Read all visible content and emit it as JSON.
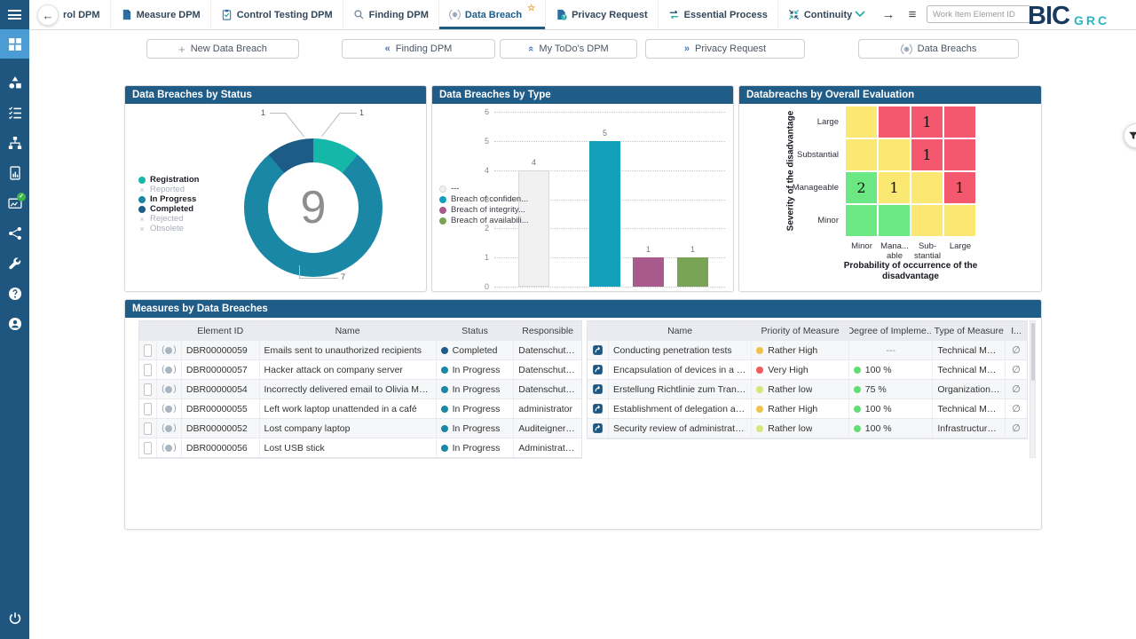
{
  "app": {
    "logo_primary": "BIC",
    "logo_secondary": "GRC",
    "work_item_placeholder": "Work Item Element ID"
  },
  "nav_icons": {
    "back": "←",
    "forward": "→",
    "menu": "≡"
  },
  "topnav": {
    "tabs": [
      {
        "label": "rol DPM",
        "icon": "none",
        "active": false,
        "starred": false
      },
      {
        "label": "Measure DPM",
        "icon": "doc",
        "active": false,
        "starred": false
      },
      {
        "label": "Control Testing DPM",
        "icon": "clipboard",
        "active": false,
        "starred": false
      },
      {
        "label": "Finding DPM",
        "icon": "magnifier",
        "active": false,
        "starred": false
      },
      {
        "label": "Data Breach",
        "icon": "breach",
        "active": true,
        "starred": true
      },
      {
        "label": "Privacy Request",
        "icon": "doc-question",
        "active": false,
        "starred": false
      },
      {
        "label": "Essential Process",
        "icon": "swap-arrows",
        "active": false,
        "starred": false
      },
      {
        "label": "Continuity Strategy",
        "icon": "collapse-arrows",
        "active": false,
        "starred": false
      }
    ]
  },
  "actions": [
    {
      "label": "New Data Breach",
      "icon": "plus"
    },
    {
      "label": "Finding DPM",
      "icon": "chevrons-left"
    },
    {
      "label": "My ToDo's DPM",
      "icon": "chevrons-up"
    },
    {
      "label": "Privacy Request",
      "icon": "chevrons-right"
    },
    {
      "label": "Data Breachs",
      "icon": "breach"
    }
  ],
  "sidebar": {
    "items": [
      {
        "icon": "dashboard",
        "active": true
      },
      {
        "icon": "shapes",
        "active": false
      },
      {
        "icon": "checklist",
        "active": false
      },
      {
        "icon": "hierarchy",
        "active": false
      },
      {
        "icon": "report",
        "active": false
      },
      {
        "icon": "approval",
        "active": false,
        "badge": true
      },
      {
        "icon": "share",
        "active": false
      },
      {
        "icon": "wrench",
        "active": false
      },
      {
        "icon": "help",
        "active": false
      },
      {
        "icon": "account",
        "active": false
      }
    ],
    "bottom_icon": "power"
  },
  "chart_data": [
    {
      "type": "donut",
      "title": "Data Breaches by Status",
      "total": 9,
      "segments": [
        {
          "label": "Registration",
          "value": 1,
          "color": "#15b7a8"
        },
        {
          "label": "In Progress",
          "value": 7,
          "color": "#1a87a5"
        },
        {
          "label": "Completed",
          "value": 1,
          "color": "#1d5c87"
        }
      ],
      "callouts": [
        {
          "value": 1,
          "segment": "Completed",
          "position": "top-left"
        },
        {
          "value": 1,
          "segment": "Registration",
          "position": "top-right"
        },
        {
          "value": 7,
          "segment": "In Progress",
          "position": "bottom"
        }
      ],
      "legend": [
        {
          "label": "Registration",
          "color": "#15b7a8",
          "enabled": true
        },
        {
          "label": "Reported",
          "color": null,
          "enabled": false
        },
        {
          "label": "In Progress",
          "color": "#1a87a5",
          "enabled": true
        },
        {
          "label": "Completed",
          "color": "#1d5c87",
          "enabled": true
        },
        {
          "label": "Rejected",
          "color": null,
          "enabled": false
        },
        {
          "label": "Obsolete",
          "color": null,
          "enabled": false
        }
      ]
    },
    {
      "type": "bar",
      "title": "Data Breaches by Type",
      "ylim": [
        0,
        6
      ],
      "yticks": [
        0,
        1,
        2,
        3,
        4,
        5,
        6
      ],
      "grid": true,
      "legend_position": "left",
      "bars": [
        {
          "label": "---",
          "value": 4,
          "color": "#f1f1f1",
          "border": "#d8d8d8"
        },
        {
          "label": "Breach of confiden...",
          "value": 5,
          "color": "#13a0ba",
          "border": "#13a0ba"
        },
        {
          "label": "Breach of integrity...",
          "value": 1,
          "color": "#a85a8c",
          "border": "#a85a8c"
        },
        {
          "label": "Breach of availabili...",
          "value": 1,
          "color": "#7aa455",
          "border": "#7aa455"
        }
      ]
    },
    {
      "type": "heatmap",
      "title": "Databreachs by Overall Evaluation",
      "ylabel": "Severity of the disadvantage",
      "xlabel_lines": [
        "Probability of occurrence of the",
        "disadvantage"
      ],
      "row_labels": [
        "Large",
        "Substantial",
        "Manageable",
        "Minor"
      ],
      "col_labels": [
        [
          "Minor"
        ],
        [
          "Mana...",
          "able"
        ],
        [
          "Sub-",
          "stantial"
        ],
        [
          "Large"
        ]
      ],
      "palette": {
        "Y": "#fae873",
        "R": "#f4586e",
        "G": "#6be784"
      },
      "cells": [
        [
          {
            "c": "Y",
            "v": null
          },
          {
            "c": "R",
            "v": null
          },
          {
            "c": "R",
            "v": 1
          },
          {
            "c": "R",
            "v": null
          }
        ],
        [
          {
            "c": "Y",
            "v": null
          },
          {
            "c": "Y",
            "v": null
          },
          {
            "c": "R",
            "v": 1
          },
          {
            "c": "R",
            "v": null
          }
        ],
        [
          {
            "c": "G",
            "v": 2
          },
          {
            "c": "Y",
            "v": 1
          },
          {
            "c": "Y",
            "v": null
          },
          {
            "c": "R",
            "v": 1
          }
        ],
        [
          {
            "c": "G",
            "v": null
          },
          {
            "c": "G",
            "v": null
          },
          {
            "c": "Y",
            "v": null
          },
          {
            "c": "Y",
            "v": null
          }
        ]
      ]
    }
  ],
  "measures": {
    "title": "Measures by Data Breaches",
    "left": {
      "headers": [
        "",
        "",
        "Element ID",
        "Name",
        "Status",
        "Responsible"
      ],
      "rows": [
        {
          "element_id": "DBR00000059",
          "name": "Emails sent to unauthorized recipients",
          "status": "Completed",
          "status_color": "#1d5c87",
          "responsible": "Datenschutzkoordi..."
        },
        {
          "element_id": "DBR00000057",
          "name": "Hacker attack on company server",
          "status": "In Progress",
          "status_color": "#1a87a5",
          "responsible": "Datenschutzkoordi..."
        },
        {
          "element_id": "DBR00000054",
          "name": "Incorrectly delivered email to Olivia Musterfrau",
          "status": "In Progress",
          "status_color": "#1a87a5",
          "responsible": "Datenschutzbeauft..."
        },
        {
          "element_id": "DBR00000055",
          "name": "Left work laptop unattended in a café",
          "status": "In Progress",
          "status_color": "#1a87a5",
          "responsible": "administrator"
        },
        {
          "element_id": "DBR00000052",
          "name": "Lost company laptop",
          "status": "In Progress",
          "status_color": "#1a87a5",
          "responsible": "Auditeigner Alexan..."
        },
        {
          "element_id": "DBR00000056",
          "name": "Lost USB stick",
          "status": "In Progress",
          "status_color": "#1a87a5",
          "responsible": "Administrator Martin"
        }
      ]
    },
    "right": {
      "headers": [
        "",
        "Name",
        "Priority of Measure",
        "Degree of Impleme...",
        "Type of Measure",
        "I..."
      ],
      "rows": [
        {
          "name": "Conducting penetration tests",
          "priority": "Rather High",
          "priority_color": "#f0c24c",
          "degree": "---",
          "degree_color": null,
          "type": "Technical Measure",
          "last": "∅"
        },
        {
          "name": "Encapsulation of devices in a Fa...",
          "priority": "Very High",
          "priority_color": "#f25b5b",
          "degree": "100 %",
          "degree_color": "#62dd72",
          "type": "Technical Measure",
          "last": "∅"
        },
        {
          "name": "Erstellung Richtlinie zum Transp...",
          "priority": "Rather low",
          "priority_color": "#d7e57a",
          "degree": "75 %",
          "degree_color": "#62dd72",
          "type": "Organizational M...",
          "last": "∅"
        },
        {
          "name": "Establishment of delegation arra...",
          "priority": "Rather High",
          "priority_color": "#f0c24c",
          "degree": "100 %",
          "degree_color": "#62dd72",
          "type": "Technical Measure",
          "last": "∅"
        },
        {
          "name": "Security review of administrators",
          "priority": "Rather low",
          "priority_color": "#d7e57a",
          "degree": "100 %",
          "degree_color": "#62dd72",
          "type": "Infrastructural M...",
          "last": "∅"
        }
      ]
    }
  }
}
